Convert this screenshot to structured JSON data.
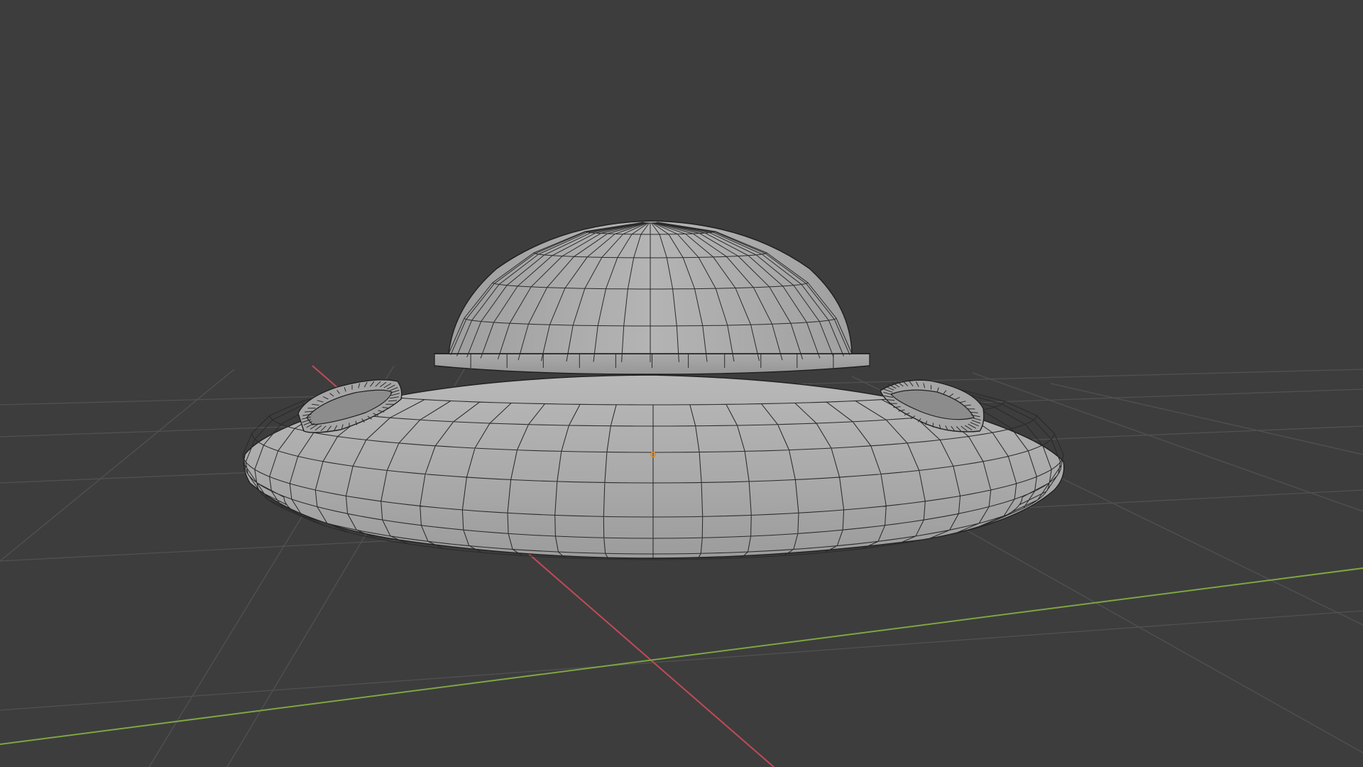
{
  "viewport": {
    "mode": "object-mode",
    "shading": "solid",
    "overlays": {
      "wireframe": true,
      "floor_grid": true,
      "x_axis": true,
      "y_axis": true,
      "origin_point": true
    }
  },
  "colors": {
    "background": "#3d3d3d",
    "grid": "#515151",
    "x_axis": "#c34a57",
    "y_axis": "#7ea641",
    "mesh_light": "#b3b3b3",
    "mesh_mid": "#a2a2a2",
    "mesh_dark": "#7f7f7f",
    "wire": "#1f1f1f",
    "origin": "#e08a1e"
  },
  "scene_object": {
    "type": "mesh",
    "shape": "flying-saucer",
    "parts": [
      "dome",
      "dome-collar",
      "saucer-body",
      "left-ring",
      "right-ring"
    ]
  }
}
